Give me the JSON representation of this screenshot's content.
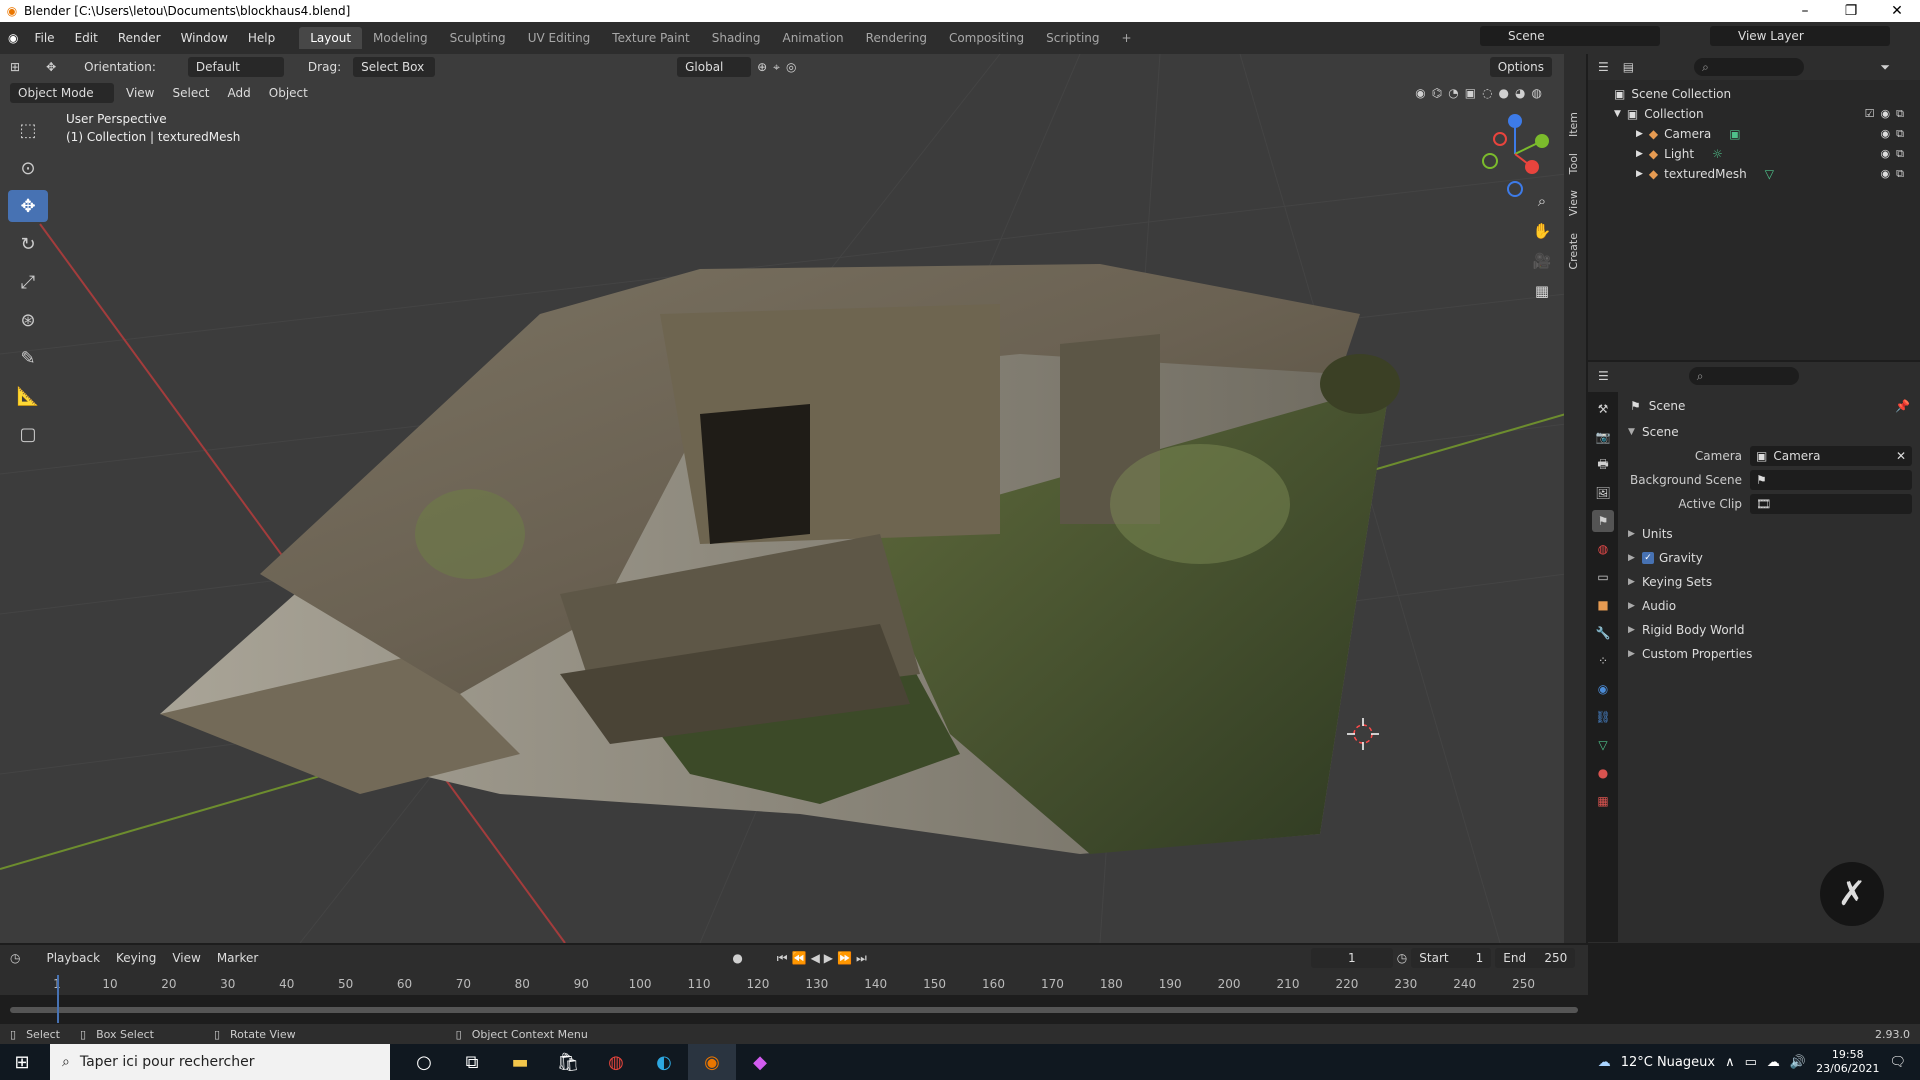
{
  "window": {
    "title": "Blender [C:\\Users\\letou\\Documents\\blockhaus4.blend]"
  },
  "menu": [
    "File",
    "Edit",
    "Render",
    "Window",
    "Help"
  ],
  "workspaces": [
    {
      "label": "Layout",
      "active": true
    },
    {
      "label": "Modeling"
    },
    {
      "label": "Sculpting"
    },
    {
      "label": "UV Editing"
    },
    {
      "label": "Texture Paint"
    },
    {
      "label": "Shading"
    },
    {
      "label": "Animation"
    },
    {
      "label": "Rendering"
    },
    {
      "label": "Compositing"
    },
    {
      "label": "Scripting"
    }
  ],
  "scene_name": "Scene",
  "view_layer": "View Layer",
  "tool_header": {
    "orientation_label": "Orientation:",
    "orientation_value": "Default",
    "drag_label": "Drag:",
    "drag_value": "Select Box",
    "transform": "Global",
    "options": "Options"
  },
  "view_header": {
    "mode": "Object Mode",
    "items": [
      "View",
      "Select",
      "Add",
      "Object"
    ]
  },
  "viewport_info": {
    "line1": "User Perspective",
    "line2": "(1) Collection | texturedMesh"
  },
  "side_tabs": [
    "Item",
    "Tool",
    "View",
    "Create"
  ],
  "outliner": {
    "root": "Scene Collection",
    "collection": "Collection",
    "items": [
      {
        "name": "Camera"
      },
      {
        "name": "Light"
      },
      {
        "name": "texturedMesh"
      }
    ]
  },
  "properties": {
    "context": "Scene",
    "panel": "Scene",
    "camera_label": "Camera",
    "camera_value": "Camera",
    "bg_label": "Background Scene",
    "clip_label": "Active Clip",
    "subpanels": [
      "Units",
      "Gravity",
      "Keying Sets",
      "Audio",
      "Rigid Body World",
      "Custom Properties"
    ]
  },
  "timeline": {
    "menus": [
      "Playback",
      "Keying",
      "View",
      "Marker"
    ],
    "current": "1",
    "start_label": "Start",
    "start": "1",
    "end_label": "End",
    "end": "250",
    "ticks": [
      "1",
      "10",
      "20",
      "30",
      "40",
      "50",
      "60",
      "70",
      "80",
      "90",
      "100",
      "110",
      "120",
      "130",
      "140",
      "150",
      "160",
      "170",
      "180",
      "190",
      "200",
      "210",
      "220",
      "230",
      "240",
      "250"
    ]
  },
  "status": {
    "select": "Select",
    "box_select": "Box Select",
    "rotate": "Rotate View",
    "context": "Object Context Menu",
    "version": "2.93.0"
  },
  "taskbar": {
    "search": "Taper ici pour rechercher",
    "weather": "12°C  Nuageux",
    "time": "19:58",
    "date": "23/06/2021"
  }
}
